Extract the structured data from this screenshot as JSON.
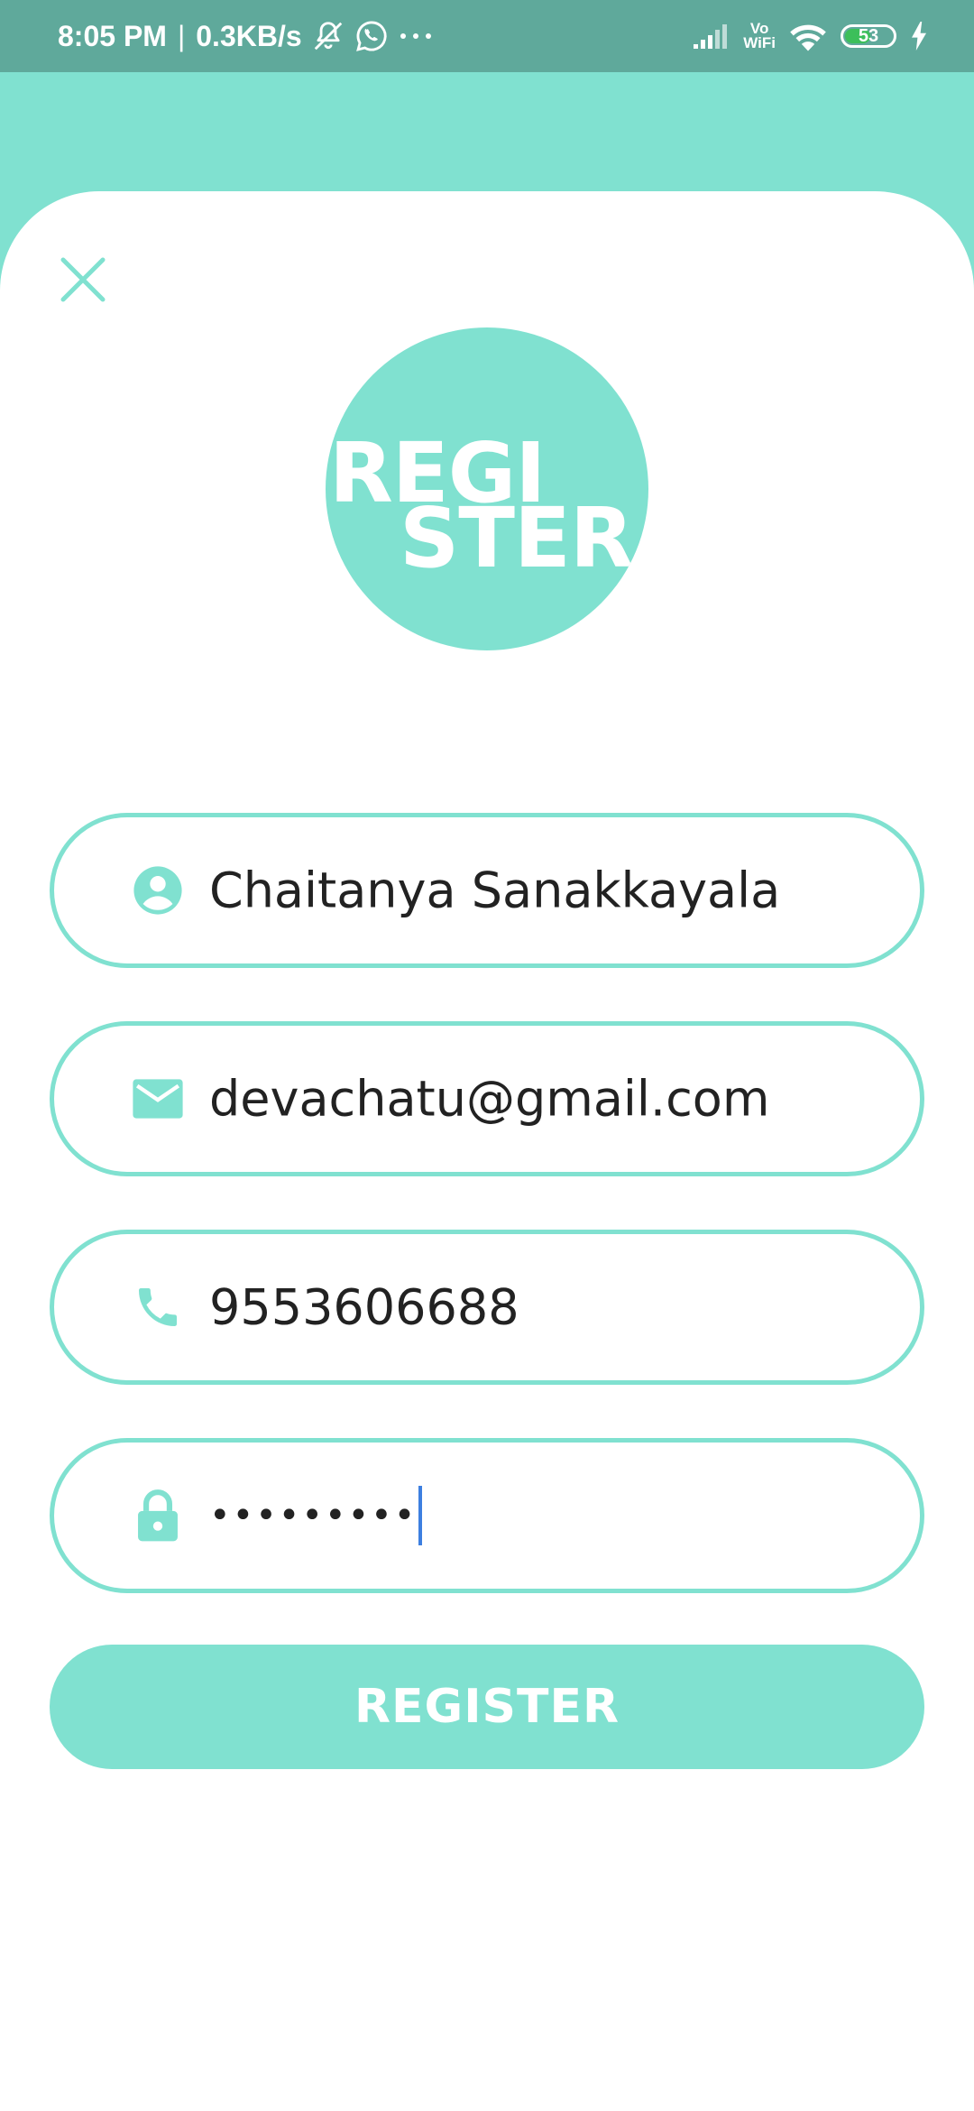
{
  "status_bar": {
    "time": "8:05 PM",
    "separator": "|",
    "network_speed": "0.3KB/s",
    "icons_left": [
      "mute-icon",
      "whatsapp-icon",
      "more-dots-icon"
    ],
    "vo_label": "Vo",
    "wifi_label": "WiFi",
    "battery_level": "53",
    "battery_fraction": 0.53,
    "icons_right": [
      "signal-icon",
      "wifi-icon",
      "battery-icon",
      "charging-icon"
    ]
  },
  "header": {
    "close_icon": "close-icon"
  },
  "logo": {
    "line1": "REGI",
    "line2": "STER"
  },
  "form": {
    "name": {
      "icon": "account-circle-icon",
      "value": "Chaitanya Sanakkayala"
    },
    "email": {
      "icon": "mail-icon",
      "value": "devachatu@gmail.com"
    },
    "phone": {
      "icon": "phone-icon",
      "value": "9553606688"
    },
    "password": {
      "icon": "lock-icon",
      "value": "•••••••••"
    }
  },
  "register_button": {
    "label": "REGISTER"
  },
  "colors": {
    "status_bar": "#5fa99b",
    "accent": "#80e1d0",
    "text": "#222222",
    "caret": "#3d7fe0",
    "battery": "#3cbf5a"
  }
}
